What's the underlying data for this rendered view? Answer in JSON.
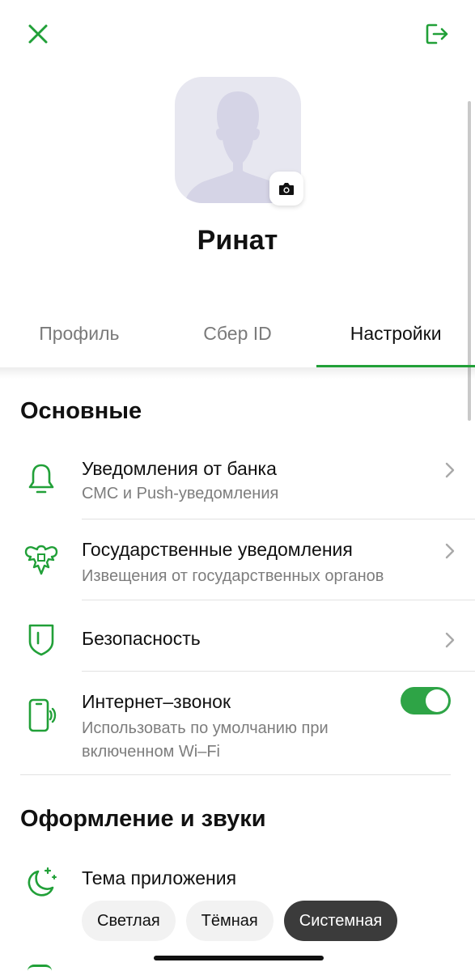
{
  "header": {
    "close_icon": "close-icon",
    "logout_icon": "logout-icon"
  },
  "profile": {
    "name": "Ринат",
    "avatar_icon": "avatar-placeholder-icon",
    "camera_icon": "camera-icon"
  },
  "tabs": [
    {
      "label": "Профиль",
      "active": false
    },
    {
      "label": "Сбер ID",
      "active": false
    },
    {
      "label": "Настройки",
      "active": true
    }
  ],
  "sections": {
    "main": {
      "title": "Основные",
      "items": [
        {
          "title": "Уведомления от банка",
          "subtitle": "СМС и Push-уведомления",
          "icon": "bell-icon"
        },
        {
          "title": "Государственные уведомления",
          "subtitle": "Извещения от государственных органов",
          "icon": "coat-of-arms-icon"
        },
        {
          "title": "Безопасность",
          "icon": "shield-icon"
        },
        {
          "title": "Интернет–звонок",
          "subtitle": "Использовать по умолчанию при включенном Wi–Fi",
          "icon": "phone-call-icon",
          "toggle_on": true
        }
      ]
    },
    "appearance": {
      "title": "Оформление и звуки",
      "theme": {
        "title": "Тема приложения",
        "icon": "moon-stars-icon",
        "options": [
          "Светлая",
          "Тёмная",
          "Системная"
        ],
        "selected": "Системная"
      }
    }
  },
  "colors": {
    "accent": "#21a038",
    "toggle_on": "#2ea446",
    "chip_selected": "#3b3b3b"
  }
}
